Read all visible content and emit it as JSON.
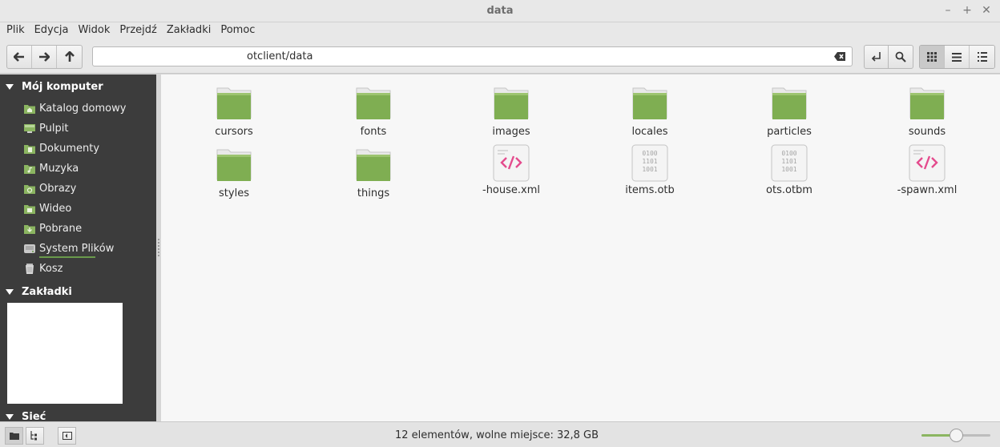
{
  "window": {
    "title": "data"
  },
  "menu": [
    "Plik",
    "Edycja",
    "Widok",
    "Przejdź",
    "Zakładki",
    "Pomoc"
  ],
  "address": {
    "path": "otclient/data"
  },
  "sidebar": {
    "computer_header": "Mój komputer",
    "computer_items": [
      {
        "label": "Katalog domowy",
        "icon": "home-folder-icon"
      },
      {
        "label": "Pulpit",
        "icon": "desktop-icon"
      },
      {
        "label": "Dokumenty",
        "icon": "documents-folder-icon"
      },
      {
        "label": "Muzyka",
        "icon": "music-folder-icon"
      },
      {
        "label": "Obrazy",
        "icon": "pictures-folder-icon"
      },
      {
        "label": "Wideo",
        "icon": "videos-folder-icon"
      },
      {
        "label": "Pobrane",
        "icon": "downloads-folder-icon"
      },
      {
        "label": "System Plików",
        "icon": "filesystem-drive-icon"
      },
      {
        "label": "Kosz",
        "icon": "trash-icon"
      }
    ],
    "bookmarks_header": "Zakładki",
    "network_header": "Sieć"
  },
  "files": [
    {
      "name": "cursors",
      "type": "folder"
    },
    {
      "name": "fonts",
      "type": "folder"
    },
    {
      "name": "images",
      "type": "folder"
    },
    {
      "name": "locales",
      "type": "folder"
    },
    {
      "name": "particles",
      "type": "folder"
    },
    {
      "name": "sounds",
      "type": "folder"
    },
    {
      "name": "styles",
      "type": "folder"
    },
    {
      "name": "things",
      "type": "folder"
    },
    {
      "name": "-house.xml",
      "type": "xml"
    },
    {
      "name": "items.otb",
      "type": "binary"
    },
    {
      "name": "ots.otbm",
      "type": "binary"
    },
    {
      "name": "-spawn.xml",
      "type": "xml"
    }
  ],
  "binary_icon_text": [
    "0100",
    "1101",
    "1001"
  ],
  "status": {
    "text": "12 elementów, wolne miejsce: 32,8 GB",
    "zoom": 0.5
  },
  "colors": {
    "accent": "#8bb561",
    "sidebar_bg": "#3c3c3c",
    "folder": "#7fae52"
  }
}
